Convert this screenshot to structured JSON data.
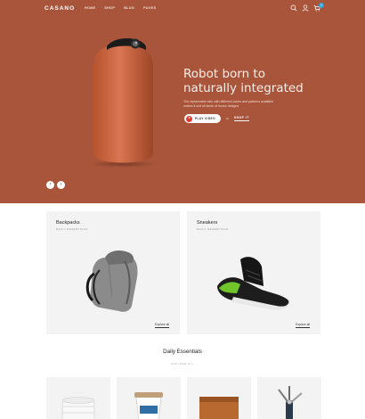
{
  "nav": {
    "logo": "CASANO",
    "menu": [
      "HOME",
      "SHOP",
      "BLOG",
      "PAGES"
    ],
    "cart_count": "0"
  },
  "hero": {
    "headline": "Robot born to naturally integrated",
    "subtext": "The replaceable skin with different colors and patterns available makes it suit all kinds of house designs",
    "play_label": "PLAY VIDEO",
    "or_text": "or",
    "shop_label": "SHOP IT",
    "prev_arrow": "‹",
    "next_arrow": "›",
    "accent_color": "#a9553b"
  },
  "categories": [
    {
      "title": "Backpacks",
      "subtitle": "DAILY ESSENTIALS",
      "link": "Explore all"
    },
    {
      "title": "Sneakers",
      "subtitle": "DAILY ESSENTIALS",
      "link": "Explore all"
    }
  ],
  "essentials": {
    "title": "Daily Essentials",
    "subtitle": "EXPLORE ALL"
  }
}
